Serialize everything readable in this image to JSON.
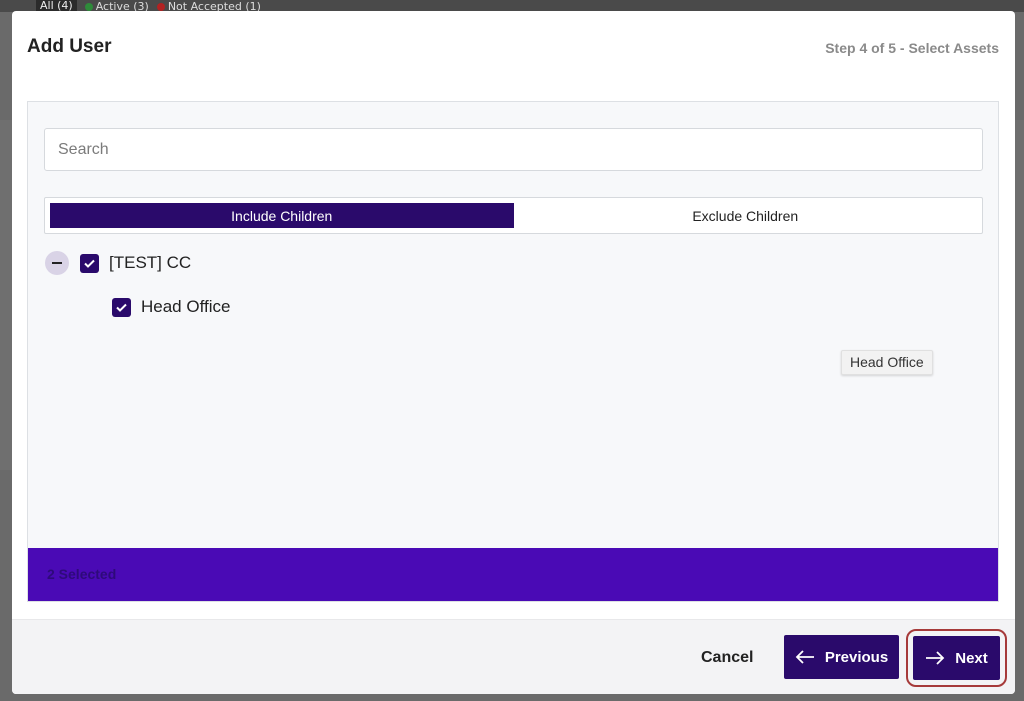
{
  "background": {
    "filters": [
      {
        "label": "All (4)"
      },
      {
        "label": "Active (3)",
        "color": "#2e8b3a"
      },
      {
        "label": "Not Accepted (1)",
        "color": "#b22222"
      }
    ]
  },
  "modal": {
    "title": "Add User",
    "step": "Step 4 of 5 - Select Assets"
  },
  "search": {
    "placeholder": "Search",
    "value": ""
  },
  "toggle": {
    "options": [
      "Include Children",
      "Exclude Children"
    ],
    "selected": "Include Children"
  },
  "tree": {
    "root": {
      "label": "[TEST] CC",
      "checked": true,
      "expanded": true,
      "children": [
        {
          "label": "Head Office",
          "checked": true
        }
      ]
    }
  },
  "tooltip": {
    "text": "Head Office"
  },
  "selection": {
    "summary": "2 Selected"
  },
  "footer": {
    "cancel_label": "Cancel",
    "previous_label": "Previous",
    "next_label": "Next"
  },
  "colors": {
    "primary": "#2a0a6b",
    "selected_bar": "#4a0ab5",
    "focus_ring": "#a63a3a"
  },
  "icons": {
    "collapse": "minus-icon",
    "checked": "checkmark-icon",
    "previous": "arrow-left-icon",
    "next": "arrow-right-icon"
  }
}
